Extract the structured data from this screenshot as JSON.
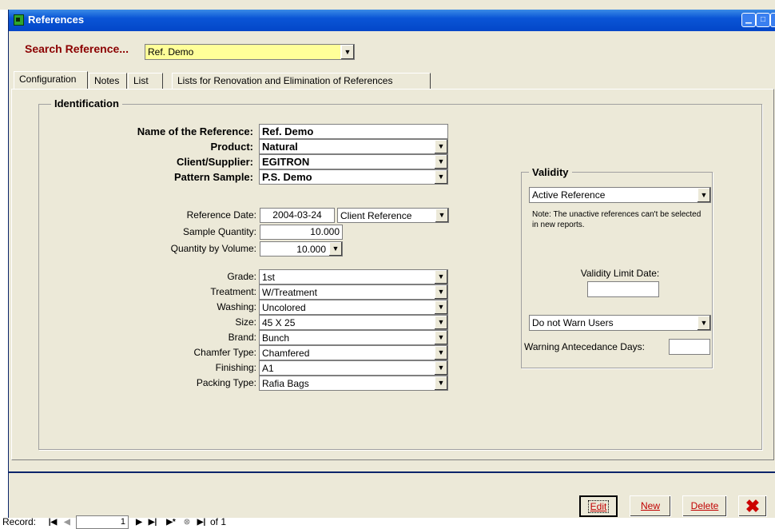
{
  "window": {
    "title": "References",
    "controls": [
      "minimize-icon",
      "maximize-icon",
      "close-icon"
    ]
  },
  "search": {
    "label": "Search Reference...",
    "value": "Ref. Demo",
    "highlight_color": "#ffff99"
  },
  "tabs": [
    {
      "label": "Configuration",
      "active": true
    },
    {
      "label": "Notes",
      "active": false
    },
    {
      "label": "List",
      "active": false
    },
    {
      "label": "Lists for Renovation and Elimination of References",
      "active": false
    }
  ],
  "identification": {
    "legend": "Identification",
    "name_label": "Name of the Reference:",
    "name_value": "Ref. Demo",
    "product_label": "Product:",
    "product_value": "Natural",
    "client_label": "Client/Supplier:",
    "client_value": "EGITRON",
    "pattern_label": "Pattern Sample:",
    "pattern_value": "P.S. Demo",
    "refdate_label": "Reference Date:",
    "refdate_value": "2004-03-24",
    "reftype_value": "Client Reference",
    "sampleqty_label": "Sample Quantity:",
    "sampleqty_value": "10.000",
    "qtyvol_label": "Quantity by Volume:",
    "qtyvol_value": "10.000",
    "attributes": [
      {
        "label": "Grade:",
        "value": "1st"
      },
      {
        "label": "Treatment:",
        "value": "W/Treatment"
      },
      {
        "label": "Washing:",
        "value": "Uncolored"
      },
      {
        "label": "Size:",
        "value": "45 X 25"
      },
      {
        "label": "Brand:",
        "value": "Bunch"
      },
      {
        "label": "Chamfer Type:",
        "value": "Chamfered"
      },
      {
        "label": "Finishing:",
        "value": "A1"
      },
      {
        "label": "Packing Type:",
        "value": "Rafia Bags"
      }
    ]
  },
  "validity": {
    "legend": "Validity",
    "status_value": "Active Reference",
    "note": "Note: The unactive references can't be selected in new reports.",
    "limit_label": "Validity Limit Date:",
    "limit_value": "",
    "warn_value": "Do not Warn Users",
    "days_label": "Warning Antecedance Days:",
    "days_value": ""
  },
  "actions": {
    "edit": "Edit",
    "new": "New",
    "delete": "Delete",
    "exit_icon": "red-x-icon",
    "accent_color": "#c00000"
  },
  "record_nav": {
    "label": "Record:",
    "current": "1",
    "of_label": "of",
    "total": "1"
  },
  "colors": {
    "title_bar": "#0a55d6",
    "window_bg": "#ece9d8",
    "search_label": "#8b0000"
  }
}
